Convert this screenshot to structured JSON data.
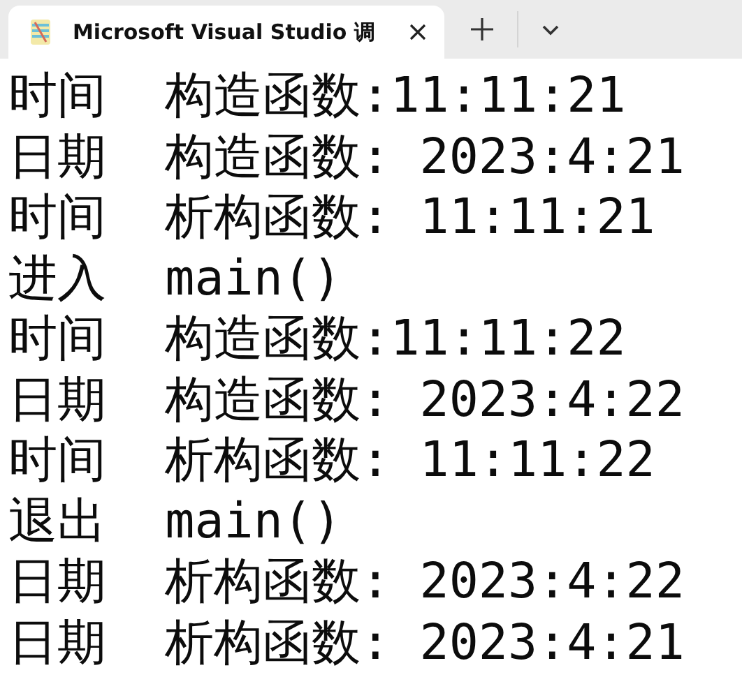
{
  "tab": {
    "title": "Microsoft Visual Studio 调",
    "selected": true
  },
  "console_lines": [
    "时间  构造函数:11:11:21",
    "日期  构造函数: 2023:4:21",
    "时间  析构函数: 11:11:21",
    "进入  main()",
    "时间  构造函数:11:11:22",
    "日期  构造函数: 2023:4:22",
    "时间  析构函数: 11:11:22",
    "退出  main()",
    "日期  析构函数: 2023:4:22",
    "日期  析构函数: 2023:4:21"
  ]
}
